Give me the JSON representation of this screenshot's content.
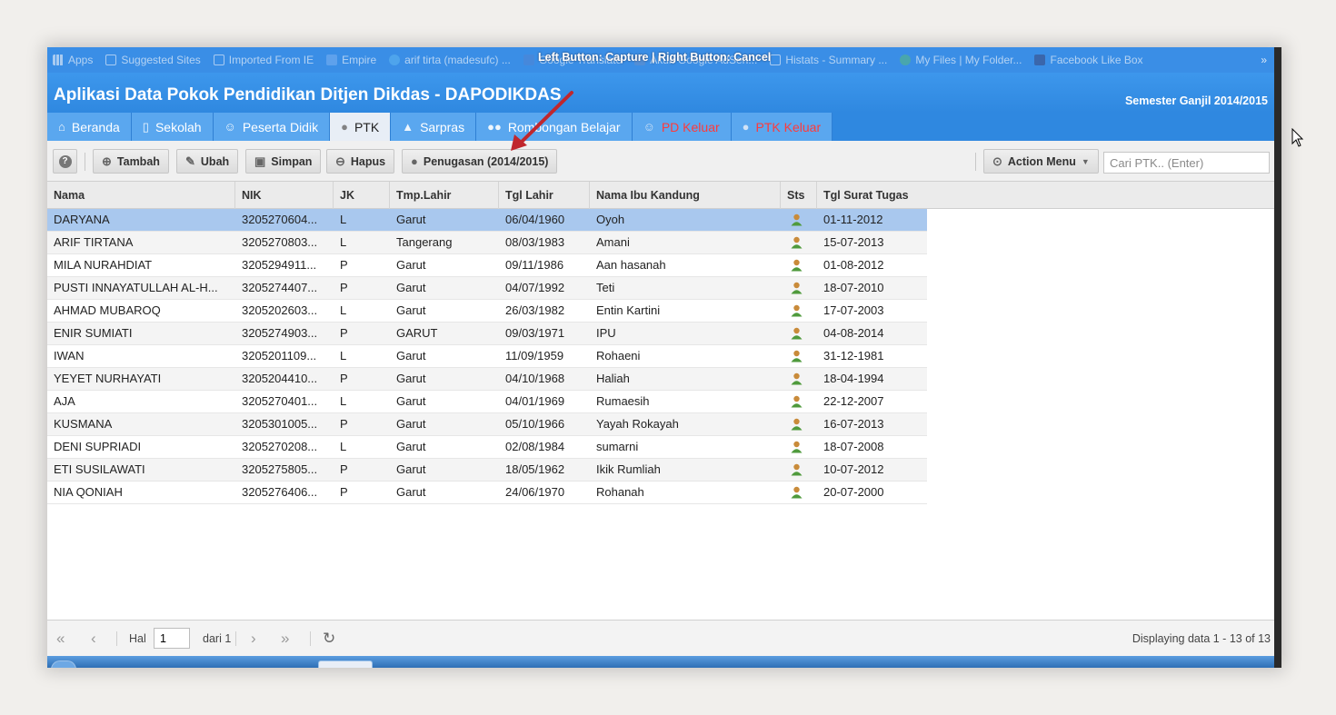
{
  "browser": {
    "capture_message": "Left Button: Capture | Right Button: Cancel",
    "bookmarks": [
      "Apps",
      "Suggested Sites",
      "Imported From IE",
      "Empire",
      "arif tirta (madesufc) ...",
      "Google Translate",
      "Akun Google AdSen...",
      "Histats - Summary ...",
      "My Files | My Folder...",
      "Facebook Like Box"
    ],
    "more": "»"
  },
  "header": {
    "title": "Aplikasi Data Pokok Pendidikan Ditjen Dikdas - DAPODIKDAS",
    "semester": "Semester Ganjil 2014/2015"
  },
  "nav": {
    "tabs": [
      {
        "label": "Beranda",
        "icon": "home-icon"
      },
      {
        "label": "Sekolah",
        "icon": "building-icon"
      },
      {
        "label": "Peserta Didik",
        "icon": "smile-icon"
      },
      {
        "label": "PTK",
        "icon": "user-icon"
      },
      {
        "label": "Sarpras",
        "icon": "road-icon"
      },
      {
        "label": "Rombongan Belajar",
        "icon": "group-icon"
      },
      {
        "label": "PD Keluar",
        "icon": "smile-icon"
      },
      {
        "label": "PTK Keluar",
        "icon": "user-icon"
      }
    ],
    "active_tab": "PTK"
  },
  "toolbar": {
    "help": "?",
    "add": "Tambah",
    "edit": "Ubah",
    "save": "Simpan",
    "delete": "Hapus",
    "assignment": "Penugasan (2014/2015)",
    "action_menu": "Action Menu",
    "search_placeholder": "Cari PTK.. (Enter)"
  },
  "grid": {
    "columns": [
      "Nama",
      "NIK",
      "JK",
      "Tmp.Lahir",
      "Tgl Lahir",
      "Nama Ibu Kandung",
      "Sts",
      "Tgl Surat Tugas"
    ],
    "rows": [
      {
        "nama": "DARYANA",
        "nik": "3205270604...",
        "jk": "L",
        "tmp": "Garut",
        "tgl": "06/04/1960",
        "ibu": "Oyoh",
        "tgs": "01-11-2012"
      },
      {
        "nama": "ARIF TIRTANA",
        "nik": "3205270803...",
        "jk": "L",
        "tmp": "Tangerang",
        "tgl": "08/03/1983",
        "ibu": "Amani",
        "tgs": "15-07-2013"
      },
      {
        "nama": "MILA NURAHDIAT",
        "nik": "3205294911...",
        "jk": "P",
        "tmp": "Garut",
        "tgl": "09/11/1986",
        "ibu": "Aan hasanah",
        "tgs": "01-08-2012"
      },
      {
        "nama": "PUSTI INNAYATULLAH AL-H...",
        "nik": "3205274407...",
        "jk": "P",
        "tmp": "Garut",
        "tgl": "04/07/1992",
        "ibu": "Teti",
        "tgs": "18-07-2010"
      },
      {
        "nama": "AHMAD MUBAROQ",
        "nik": "3205202603...",
        "jk": "L",
        "tmp": "Garut",
        "tgl": "26/03/1982",
        "ibu": "Entin Kartini",
        "tgs": "17-07-2003"
      },
      {
        "nama": "ENIR SUMIATI",
        "nik": "3205274903...",
        "jk": "P",
        "tmp": "GARUT",
        "tgl": "09/03/1971",
        "ibu": "IPU",
        "tgs": "04-08-2014"
      },
      {
        "nama": "IWAN",
        "nik": "3205201109...",
        "jk": "L",
        "tmp": "Garut",
        "tgl": "11/09/1959",
        "ibu": "Rohaeni",
        "tgs": "31-12-1981"
      },
      {
        "nama": "YEYET NURHAYATI",
        "nik": "3205204410...",
        "jk": "P",
        "tmp": "Garut",
        "tgl": "04/10/1968",
        "ibu": "Haliah",
        "tgs": "18-04-1994"
      },
      {
        "nama": "AJA",
        "nik": "3205270401...",
        "jk": "L",
        "tmp": "Garut",
        "tgl": "04/01/1969",
        "ibu": "Rumaesih",
        "tgs": "22-12-2007"
      },
      {
        "nama": "KUSMANA",
        "nik": "3205301005...",
        "jk": "P",
        "tmp": "Garut",
        "tgl": "05/10/1966",
        "ibu": "Yayah Rokayah",
        "tgs": "16-07-2013"
      },
      {
        "nama": "DENI SUPRIADI",
        "nik": "3205270208...",
        "jk": "L",
        "tmp": "Garut",
        "tgl": "02/08/1984",
        "ibu": "sumarni",
        "tgs": "18-07-2008"
      },
      {
        "nama": "ETI SUSILAWATI",
        "nik": "3205275805...",
        "jk": "P",
        "tmp": "Garut",
        "tgl": "18/05/1962",
        "ibu": "Ikik Rumliah",
        "tgs": "10-07-2012"
      },
      {
        "nama": "NIA QONIAH",
        "nik": "3205276406...",
        "jk": "P",
        "tmp": "Garut",
        "tgl": "24/06/1970",
        "ibu": "Rohanah",
        "tgs": "20-07-2000"
      }
    ],
    "selected_row": 0
  },
  "pager": {
    "page_label": "Hal",
    "page_value": "1",
    "of_label": "dari 1",
    "display_info": "Displaying data 1 - 13 of 13"
  },
  "colors": {
    "header_blue": "#3d97ec",
    "tab_blue": "#5aa7ef",
    "selected_row": "#a9c8ee",
    "alert_red": "#ff3a3a",
    "annotation_arrow": "#c0272d"
  }
}
